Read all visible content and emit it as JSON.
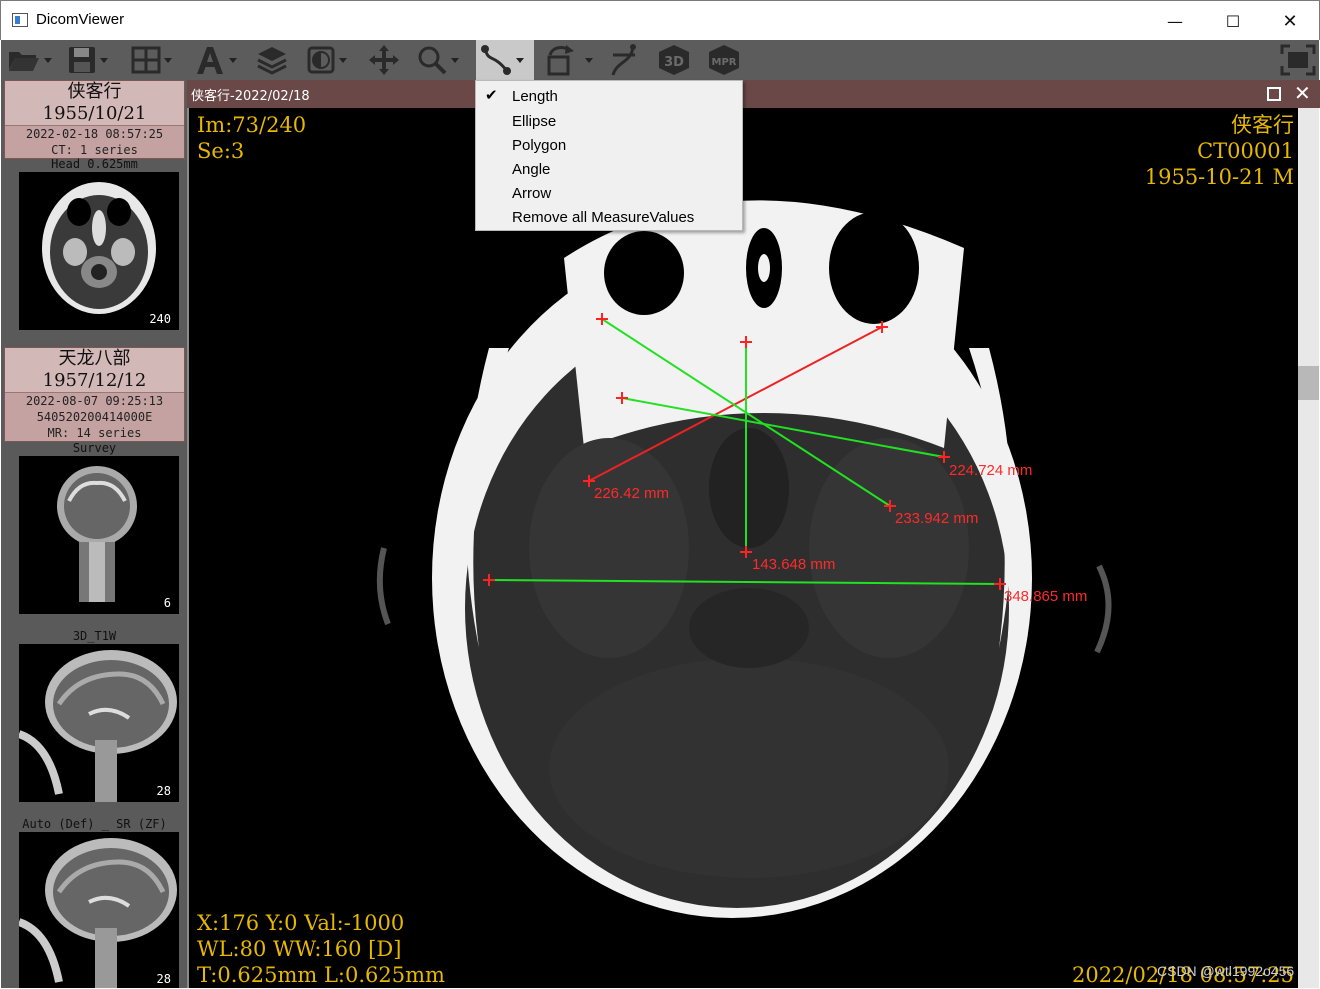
{
  "window": {
    "title": "DicomViewer",
    "min_glyph": "—",
    "max_glyph": "☐",
    "close_glyph": "✕"
  },
  "toolbar": {
    "items": [
      "open-folder-icon",
      "save-icon",
      "layout-grid-icon",
      "annotation-text-icon",
      "layers-icon",
      "window-level-icon",
      "pan-icon",
      "zoom-icon",
      "measure-icon",
      "rotate-icon",
      "curve-icon",
      "3d-icon",
      "mpr-icon",
      "fullscreen-icon"
    ],
    "labels": {
      "three_d": "3D",
      "mpr": "MPR"
    }
  },
  "patients": [
    {
      "name": "侠客行",
      "dob": "1955/10/21",
      "study_time": "2022-02-18 08:57:25",
      "study_info": "CT: 1 series",
      "series": [
        {
          "label": "Head 0.625mm",
          "count": "240"
        }
      ]
    },
    {
      "name": "天龙八部",
      "dob": "1957/12/12",
      "study_time": "2022-08-07 09:25:13",
      "study_id": "540520200414000E",
      "study_info": "MR: 14 series",
      "series": [
        {
          "label": "Survey",
          "count": "6"
        },
        {
          "label": "3D_T1W",
          "count": "28"
        },
        {
          "label": "Auto (Def) _ SR (ZF)",
          "count": "28"
        }
      ]
    }
  ],
  "viewer": {
    "title": "侠客行-2022/02/18",
    "top_left": [
      "Im:73/240",
      "Se:3"
    ],
    "top_right": [
      "侠客行",
      "CT00001",
      "1955-10-21 M"
    ],
    "bottom_left": [
      "X:176 Y:0 Val:-1000",
      "WL:80 WW:160 [D]",
      "T:0.625mm L:0.625mm"
    ],
    "bottom_right": "2022/02/18 08:57:25",
    "measurements": [
      "226.42 mm",
      "224.724 mm",
      "233.942 mm",
      "143.648 mm",
      "348.865 mm"
    ]
  },
  "menu": {
    "items": [
      {
        "label": "Length",
        "checked": true
      },
      {
        "label": "Ellipse",
        "checked": false
      },
      {
        "label": "Polygon",
        "checked": false
      },
      {
        "label": "Angle",
        "checked": false
      },
      {
        "label": "Arrow",
        "checked": false
      },
      {
        "label": "Remove all MeasureValues",
        "checked": false
      }
    ],
    "check_glyph": "✔"
  },
  "watermark": "CSDN @wtl1992o456",
  "colors": {
    "overlay_text": "#e6b800",
    "measure_label": "#ff2a2a",
    "measure_line_green": "#22e022",
    "measure_line_red": "#ee2222",
    "patient_header": "#d3b8b8",
    "viewer_header": "#6b4848",
    "toolbar_bg": "#5c5c5c"
  }
}
